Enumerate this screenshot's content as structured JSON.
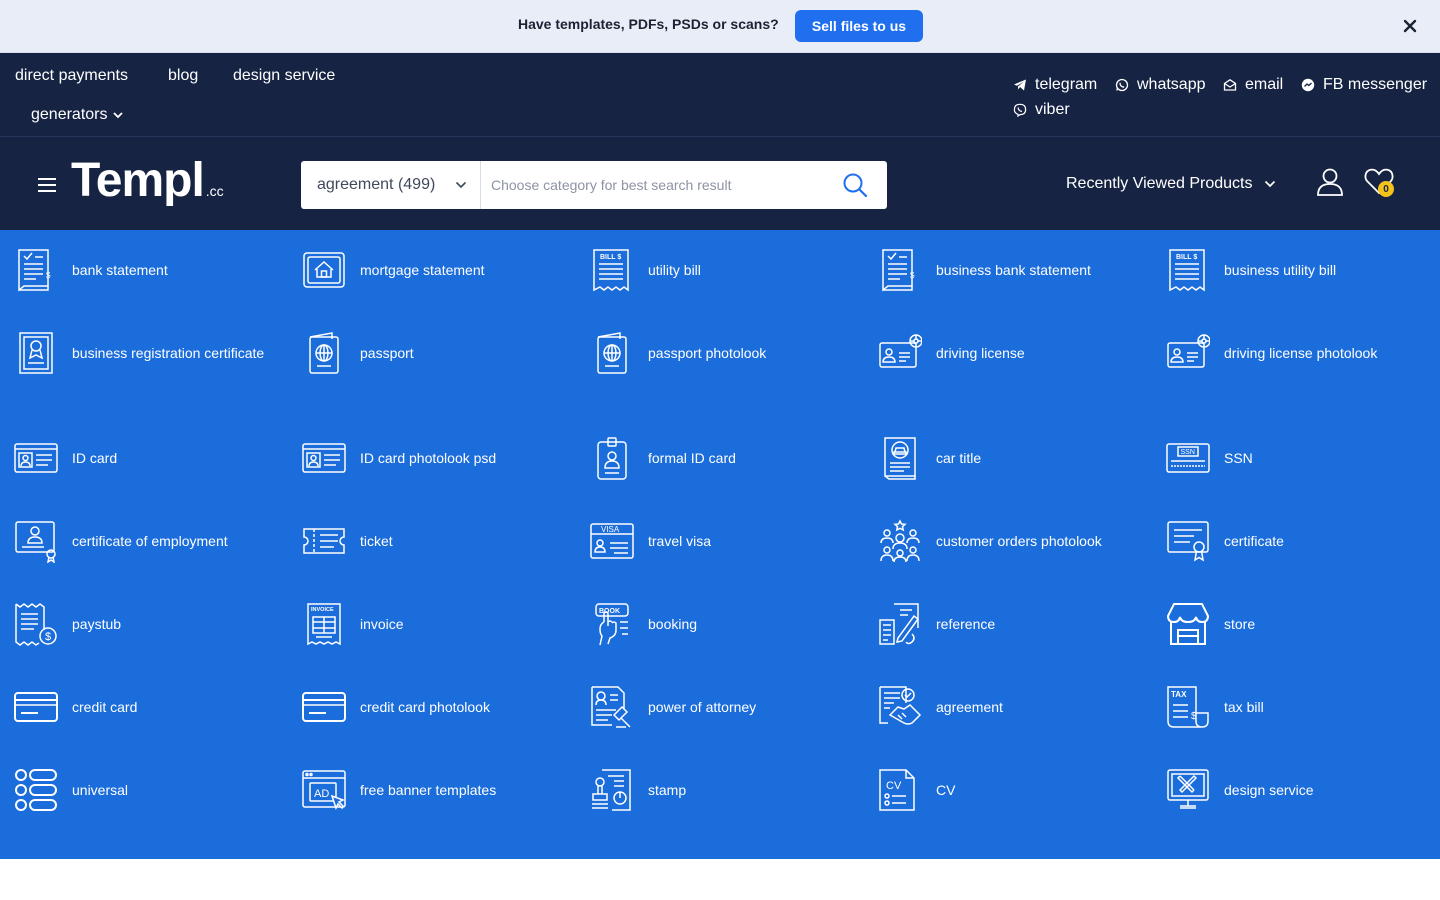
{
  "promo": {
    "text": "Have templates, PDFs, PSDs or scans?",
    "button": "Sell files to us"
  },
  "nav": {
    "links": [
      "direct payments",
      "blog",
      "design service"
    ],
    "generators": "generators",
    "contacts": [
      {
        "label": "telegram",
        "icon": "telegram-icon"
      },
      {
        "label": "whatsapp",
        "icon": "whatsapp-icon"
      },
      {
        "label": "email",
        "icon": "email-icon"
      },
      {
        "label": "FB messenger",
        "icon": "messenger-icon"
      },
      {
        "label": "viber",
        "icon": "viber-icon"
      }
    ]
  },
  "header": {
    "logo_main": "Templ",
    "logo_suffix": ".cc",
    "category_selected": "agreement",
    "category_count": "(499)",
    "search_placeholder": "Choose category for best search result",
    "recently_viewed": "Recently Viewed Products",
    "favorites_count": "0"
  },
  "categories": [
    {
      "label": "bank statement",
      "icon": "bank-statement-icon"
    },
    {
      "label": "mortgage statement",
      "icon": "mortgage-statement-icon"
    },
    {
      "label": "utility bill",
      "icon": "utility-bill-icon"
    },
    {
      "label": "business bank statement",
      "icon": "business-bank-statement-icon"
    },
    {
      "label": "business utility bill",
      "icon": "business-utility-bill-icon"
    },
    {
      "label": "business registration certificate",
      "icon": "business-registration-icon"
    },
    {
      "label": "passport",
      "icon": "passport-icon"
    },
    {
      "label": "passport photolook",
      "icon": "passport-photolook-icon"
    },
    {
      "label": "driving license",
      "icon": "driving-license-icon"
    },
    {
      "label": "driving license photolook",
      "icon": "driving-license-photolook-icon"
    },
    {
      "label": "ID card",
      "icon": "id-card-icon"
    },
    {
      "label": "ID card photolook psd",
      "icon": "id-card-photolook-icon"
    },
    {
      "label": "formal ID card",
      "icon": "formal-id-card-icon"
    },
    {
      "label": "car title",
      "icon": "car-title-icon"
    },
    {
      "label": "SSN",
      "icon": "ssn-icon"
    },
    {
      "label": "certificate of employment",
      "icon": "certificate-of-employment-icon"
    },
    {
      "label": "ticket",
      "icon": "ticket-icon"
    },
    {
      "label": "travel visa",
      "icon": "travel-visa-icon"
    },
    {
      "label": "customer orders photolook",
      "icon": "customer-orders-icon"
    },
    {
      "label": "certificate",
      "icon": "certificate-icon"
    },
    {
      "label": "paystub",
      "icon": "paystub-icon"
    },
    {
      "label": "invoice",
      "icon": "invoice-icon"
    },
    {
      "label": "booking",
      "icon": "booking-icon"
    },
    {
      "label": "reference",
      "icon": "reference-icon"
    },
    {
      "label": "store",
      "icon": "store-icon"
    },
    {
      "label": "credit card",
      "icon": "credit-card-icon"
    },
    {
      "label": "credit card photolook",
      "icon": "credit-card-photolook-icon"
    },
    {
      "label": "power of attorney",
      "icon": "power-of-attorney-icon"
    },
    {
      "label": "agreement",
      "icon": "agreement-icon"
    },
    {
      "label": "tax bill",
      "icon": "tax-bill-icon"
    },
    {
      "label": "universal",
      "icon": "universal-icon"
    },
    {
      "label": "free banner templates",
      "icon": "banner-templates-icon"
    },
    {
      "label": "stamp",
      "icon": "stamp-icon"
    },
    {
      "label": "CV",
      "icon": "cv-icon"
    },
    {
      "label": "design service",
      "icon": "design-service-icon"
    }
  ],
  "icon_text": {
    "bill": "BILL $",
    "visa": "VISA",
    "ssn": "SSN",
    "invoice": "INVOICE",
    "book": "BOOK",
    "tax": "TAX",
    "ad": "AD",
    "cv": "CV"
  },
  "colors": {
    "promo_bg": "#e8edf8",
    "accent_button": "#1f6fee",
    "nav_bg": "#162342",
    "grid_bg": "#1b6ddb",
    "badge": "#f3c21b"
  }
}
